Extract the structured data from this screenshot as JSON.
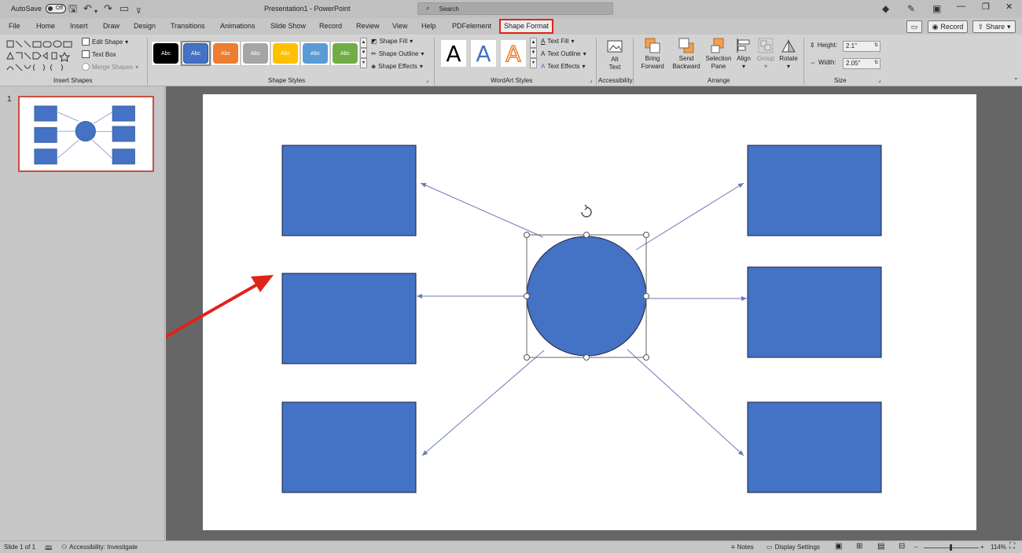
{
  "titlebar": {
    "autosave_label": "AutoSave",
    "autosave_state": "Off",
    "doc_title": "Presentation1  -  PowerPoint",
    "search_placeholder": "Search"
  },
  "tabs": [
    "File",
    "Home",
    "Insert",
    "Draw",
    "Design",
    "Transitions",
    "Animations",
    "Slide Show",
    "Record",
    "Review",
    "View",
    "Help",
    "PDFelement",
    "Shape Format"
  ],
  "active_tab": "Shape Format",
  "right_buttons": {
    "record": "Record",
    "share": "Share"
  },
  "ribbon": {
    "insert_shapes": {
      "label": "Insert Shapes",
      "edit_shape": "Edit Shape",
      "text_box": "Text Box",
      "merge_shapes": "Merge Shapes"
    },
    "shape_styles": {
      "label": "Shape Styles",
      "swatch_text": "Abc",
      "shape_fill": "Shape Fill",
      "shape_outline": "Shape Outline",
      "shape_effects": "Shape Effects",
      "swatch_colors": [
        "#000000",
        "#4472c4",
        "#ed7d31",
        "#a5a5a5",
        "#ffc000",
        "#5b9bd5",
        "#70ad47"
      ]
    },
    "wordart": {
      "label": "WordArt Styles",
      "glyph": "A",
      "text_fill": "Text Fill",
      "text_outline": "Text Outline",
      "text_effects": "Text Effects"
    },
    "accessibility": {
      "label": "Accessibility",
      "alt_text_1": "Alt",
      "alt_text_2": "Text"
    },
    "arrange": {
      "label": "Arrange",
      "bring_forward_1": "Bring",
      "bring_forward_2": "Forward",
      "send_backward_1": "Send",
      "send_backward_2": "Backward",
      "selection_pane_1": "Selection",
      "selection_pane_2": "Pane",
      "align": "Align",
      "group": "Group",
      "rotate": "Rotate"
    },
    "size": {
      "label": "Size",
      "height_label": "Height:",
      "height_value": "2.1\"",
      "width_label": "Width:",
      "width_value": "2.05\""
    }
  },
  "slide_panel": {
    "slide_number": "1"
  },
  "slide": {
    "shape_fill": "#4472c4",
    "arrow_color": "#6a7ab8",
    "annotation_color": "#e0231a"
  },
  "statusbar": {
    "slide_info": "Slide 1 of 1",
    "accessibility": "Accessibility: Investigate",
    "notes": "Notes",
    "display_settings": "Display Settings",
    "zoom": "114%"
  }
}
